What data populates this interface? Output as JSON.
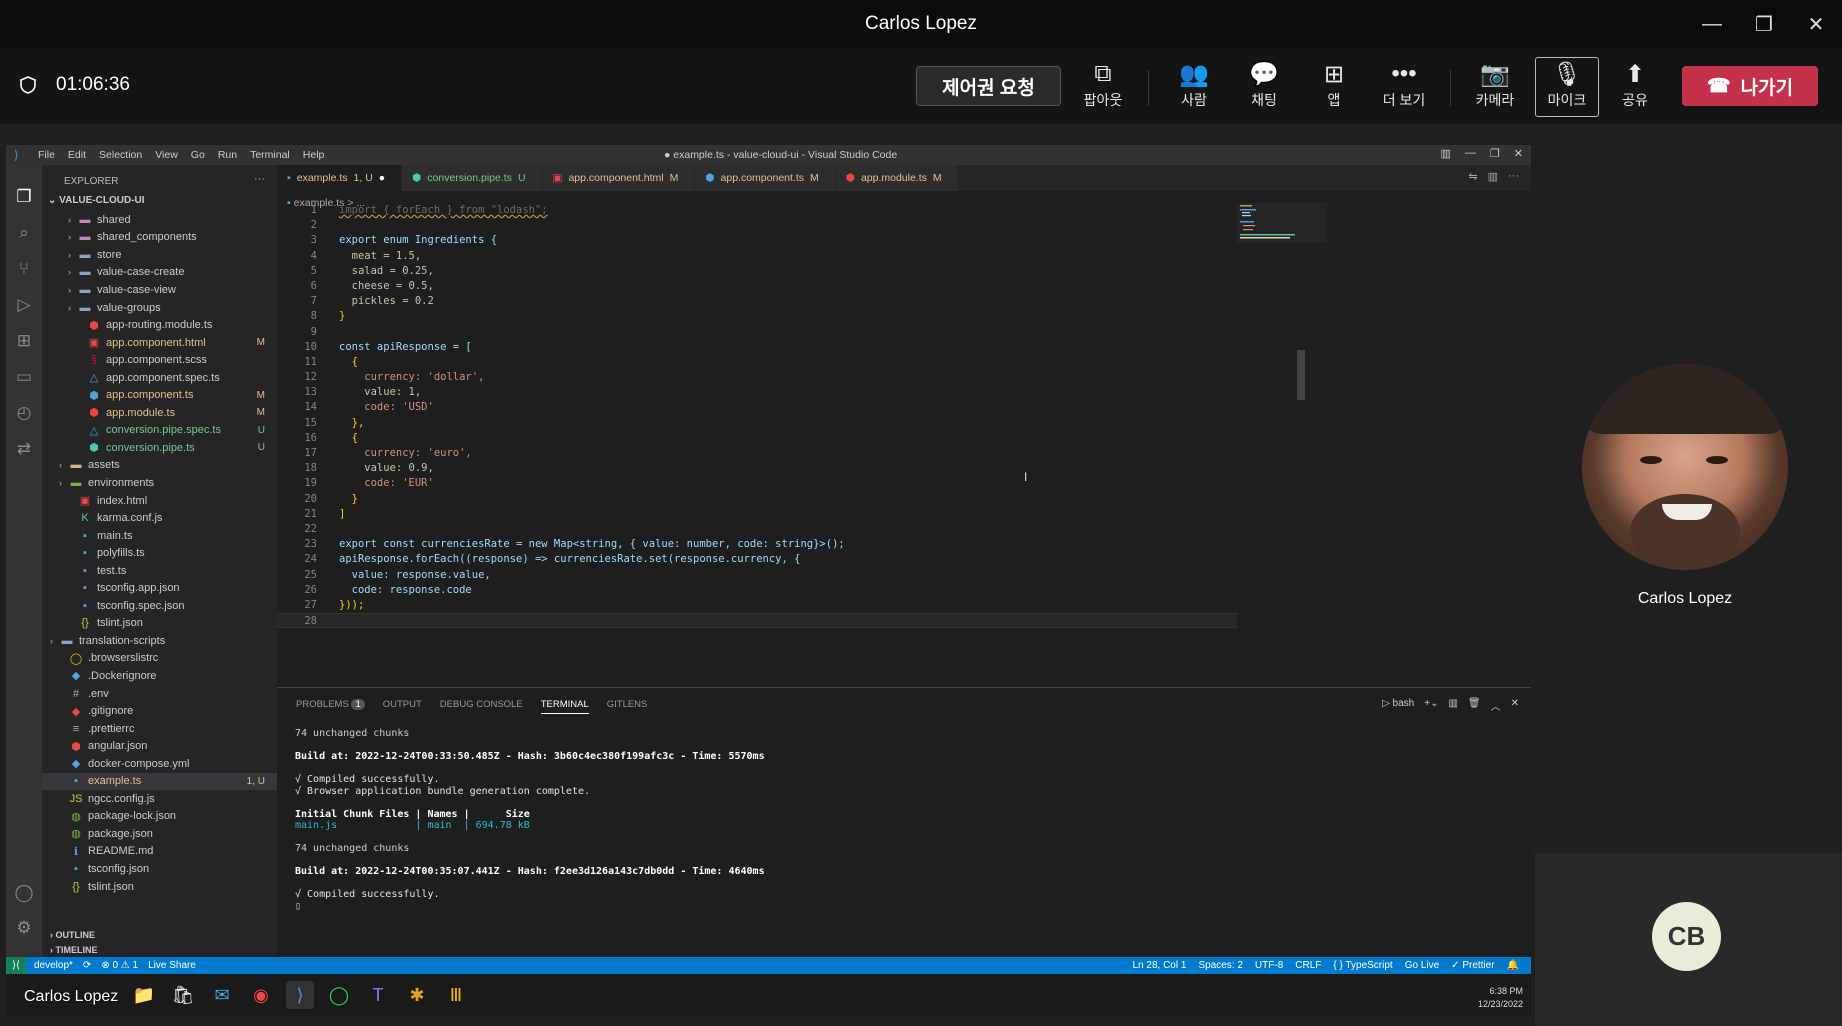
{
  "window": {
    "title": "Carlos Lopez",
    "controls": [
      "—",
      "❐",
      "✕"
    ]
  },
  "meeting": {
    "timer": "01:06:36",
    "request_control": "제어권 요청",
    "buttons": [
      {
        "label": "팝아웃",
        "icon": "popout-icon",
        "glyph": "⧉"
      },
      {
        "label": "사람",
        "icon": "people-icon",
        "glyph": "👥"
      },
      {
        "label": "채팅",
        "icon": "chat-icon",
        "glyph": "💬"
      },
      {
        "label": "앱",
        "icon": "apps-icon",
        "glyph": "⊞"
      },
      {
        "label": "더 보기",
        "icon": "more-icon",
        "glyph": "•••"
      },
      {
        "label": "카메라",
        "icon": "camera-off-icon",
        "glyph": "📷"
      },
      {
        "label": "마이크",
        "icon": "mic-icon",
        "glyph": "🎙"
      },
      {
        "label": "공유",
        "icon": "share-icon",
        "glyph": "⬆"
      }
    ],
    "leave": "나가기"
  },
  "vscode": {
    "menu": [
      "File",
      "Edit",
      "Selection",
      "View",
      "Go",
      "Run",
      "Terminal",
      "Help"
    ],
    "title": "● example.ts - value-cloud-ui - Visual Studio Code",
    "explorer_header": "EXPLORER",
    "root": "VALUE-CLOUD-UI",
    "tree": [
      {
        "label": "shared",
        "type": "folder",
        "indent": 2,
        "color": "#c586c0"
      },
      {
        "label": "shared_components",
        "type": "folder",
        "indent": 2,
        "color": "#c586c0"
      },
      {
        "label": "store",
        "type": "folder",
        "indent": 2,
        "color": "#8aa4c8"
      },
      {
        "label": "value-case-create",
        "type": "folder",
        "indent": 2,
        "color": "#8aa4c8"
      },
      {
        "label": "value-case-view",
        "type": "folder",
        "indent": 2,
        "color": "#8aa4c8"
      },
      {
        "label": "value-groups",
        "type": "folder",
        "indent": 2,
        "color": "#8aa4c8"
      },
      {
        "label": "app-routing.module.ts",
        "type": "file",
        "indent": 3,
        "icon": "⬢",
        "color": "#e44",
        "text": "#ccc"
      },
      {
        "label": "app.component.html",
        "type": "file",
        "indent": 3,
        "icon": "▣",
        "color": "#e44",
        "text": "#e2c08d",
        "status": "M"
      },
      {
        "label": "app.component.scss",
        "type": "file",
        "indent": 3,
        "icon": "§",
        "color": "#d06",
        "text": "#ccc"
      },
      {
        "label": "app.component.spec.ts",
        "type": "file",
        "indent": 3,
        "icon": "△",
        "color": "#4fa3e0",
        "text": "#ccc"
      },
      {
        "label": "app.component.ts",
        "type": "file",
        "indent": 3,
        "icon": "⬢",
        "color": "#4fa3e0",
        "text": "#e2c08d",
        "status": "M"
      },
      {
        "label": "app.module.ts",
        "type": "file",
        "indent": 3,
        "icon": "⬢",
        "color": "#e44",
        "text": "#e2c08d",
        "status": "M"
      },
      {
        "label": "conversion.pipe.spec.ts",
        "type": "file",
        "indent": 3,
        "icon": "△",
        "color": "#4fa3e0",
        "text": "#73c991",
        "status": "U"
      },
      {
        "label": "conversion.pipe.ts",
        "type": "file",
        "indent": 3,
        "icon": "⬢",
        "color": "#4ec9b0",
        "text": "#73c991",
        "status": "U"
      },
      {
        "label": "assets",
        "type": "folder",
        "indent": 1,
        "color": "#dcb67a"
      },
      {
        "label": "environments",
        "type": "folder",
        "indent": 1,
        "color": "#7cb342"
      },
      {
        "label": "index.html",
        "type": "file",
        "indent": 2,
        "icon": "▣",
        "color": "#e44",
        "text": "#ccc"
      },
      {
        "label": "karma.conf.js",
        "type": "file",
        "indent": 2,
        "icon": "K",
        "color": "#4ec9b0",
        "text": "#ccc"
      },
      {
        "label": "main.ts",
        "type": "file",
        "indent": 2,
        "icon": "▪",
        "color": "#4fa3e0",
        "text": "#ccc"
      },
      {
        "label": "polyfills.ts",
        "type": "file",
        "indent": 2,
        "icon": "▪",
        "color": "#4fa3e0",
        "text": "#ccc"
      },
      {
        "label": "test.ts",
        "type": "file",
        "indent": 2,
        "icon": "▪",
        "color": "#4fa3e0",
        "text": "#ccc"
      },
      {
        "label": "tsconfig.app.json",
        "type": "file",
        "indent": 2,
        "icon": "▪",
        "color": "#4fa3e0",
        "text": "#ccc"
      },
      {
        "label": "tsconfig.spec.json",
        "type": "file",
        "indent": 2,
        "icon": "▪",
        "color": "#4fa3e0",
        "text": "#ccc"
      },
      {
        "label": "tslint.json",
        "type": "file",
        "indent": 2,
        "icon": "{}",
        "color": "#cbcb41",
        "text": "#ccc"
      },
      {
        "label": "translation-scripts",
        "type": "folder",
        "indent": 0,
        "color": "#8aa4c8"
      },
      {
        "label": ".browserslistrc",
        "type": "file",
        "indent": 1,
        "icon": "◯",
        "color": "#f5b800",
        "text": "#ccc"
      },
      {
        "label": ".Dockerignore",
        "type": "file",
        "indent": 1,
        "icon": "◆",
        "color": "#4fa3e0",
        "text": "#ccc"
      },
      {
        "label": ".env",
        "type": "file",
        "indent": 1,
        "icon": "#",
        "color": "#aaa",
        "text": "#ccc"
      },
      {
        "label": ".gitignore",
        "type": "file",
        "indent": 1,
        "icon": "◆",
        "color": "#e44",
        "text": "#ccc"
      },
      {
        "label": ".prettierrc",
        "type": "file",
        "indent": 1,
        "icon": "≡",
        "color": "#aaa",
        "text": "#ccc"
      },
      {
        "label": "angular.json",
        "type": "file",
        "indent": 1,
        "icon": "⬢",
        "color": "#e44",
        "text": "#ccc"
      },
      {
        "label": "docker-compose.yml",
        "type": "file",
        "indent": 1,
        "icon": "◆",
        "color": "#4fa3e0",
        "text": "#ccc"
      },
      {
        "label": "example.ts",
        "type": "file",
        "indent": 1,
        "icon": "▪",
        "color": "#4fa3e0",
        "text": "#e2c08d",
        "status": "1, U",
        "selected": true
      },
      {
        "label": "ngcc.config.js",
        "type": "file",
        "indent": 1,
        "icon": "JS",
        "color": "#cbcb41",
        "text": "#ccc"
      },
      {
        "label": "package-lock.json",
        "type": "file",
        "indent": 1,
        "icon": "◍",
        "color": "#7cb342",
        "text": "#ccc"
      },
      {
        "label": "package.json",
        "type": "file",
        "indent": 1,
        "icon": "◍",
        "color": "#7cb342",
        "text": "#ccc"
      },
      {
        "label": "README.md",
        "type": "file",
        "indent": 1,
        "icon": "ℹ",
        "color": "#4fa3e0",
        "text": "#ccc"
      },
      {
        "label": "tsconfig.json",
        "type": "file",
        "indent": 1,
        "icon": "▪",
        "color": "#4fa3e0",
        "text": "#ccc"
      },
      {
        "label": "tslint.json",
        "type": "file",
        "indent": 1,
        "icon": "{}",
        "color": "#cbcb41",
        "text": "#ccc"
      }
    ],
    "outline": "OUTLINE",
    "timeline": "TIMELINE",
    "tabs": [
      {
        "label": "example.ts",
        "suffix": "1, U",
        "dirty": "●",
        "active": true,
        "color": "#e2c08d",
        "icon": "▪",
        "icon_color": "#4fa3e0"
      },
      {
        "label": "conversion.pipe.ts",
        "suffix": "U",
        "active": false,
        "color": "#73c991",
        "icon": "⬢",
        "icon_color": "#4ec9b0"
      },
      {
        "label": "app.component.html",
        "suffix": "M",
        "active": false,
        "color": "#e2c08d",
        "icon": "▣",
        "icon_color": "#e44"
      },
      {
        "label": "app.component.ts",
        "suffix": "M",
        "active": false,
        "color": "#e2c08d",
        "icon": "⬢",
        "icon_color": "#4fa3e0"
      },
      {
        "label": "app.module.ts",
        "suffix": "M",
        "active": false,
        "color": "#e2c08d",
        "icon": "⬢",
        "icon_color": "#e44"
      }
    ],
    "breadcrumb": "example.ts > ...",
    "code_lines": [
      "import { forEach } from \"lodash\";",
      "",
      "export enum Ingredients {",
      "  meat = 1.5,",
      "  salad = 0.25,",
      "  cheese = 0.5,",
      "  pickles = 0.2",
      "}",
      "",
      "const apiResponse = [",
      "  {",
      "    currency: 'dollar',",
      "    value: 1,",
      "    code: 'USD'",
      "  },",
      "  {",
      "    currency: 'euro',",
      "    value: 0.9,",
      "    code: 'EUR'",
      "  }",
      "]",
      "",
      "export const currenciesRate = new Map<string, { value: number, code: string}>();",
      "apiResponse.forEach((response) => currenciesRate.set(response.currency, {",
      "  value: response.value,",
      "  code: response.code",
      "}));",
      ""
    ],
    "panel_tabs": [
      "PROBLEMS",
      "OUTPUT",
      "DEBUG CONSOLE",
      "TERMINAL",
      "GITLENS"
    ],
    "problems_count": "1",
    "terminal_shell": "bash",
    "terminal_lines": [
      "74 unchanged chunks",
      "",
      "Build at: 2022-12-24T00:33:50.485Z - Hash: 3b60c4ec380f199afc3c - Time: 5570ms",
      "",
      "√ Compiled successfully.",
      "√ Browser application bundle generation complete.",
      "",
      "Initial Chunk Files | Names |      Size",
      "main.js             | main  | 694.78 kB",
      "",
      "74 unchanged chunks",
      "",
      "Build at: 2022-12-24T00:35:07.441Z - Hash: f2ee3d126a143c7db0dd - Time: 4640ms",
      "",
      "√ Compiled successfully.",
      "▯"
    ],
    "status_left": [
      "develop*",
      "⟳",
      "⊗ 0 ⚠ 1",
      "Live Share"
    ],
    "status_right": [
      "Ln 28, Col 1",
      "Spaces: 2",
      "UTF-8",
      "CRLF",
      "{ } TypeScript",
      "Go Live",
      "✓ Prettier"
    ],
    "clock_time": "6:38 PM",
    "clock_date": "12/23/2022",
    "caption": "Carlos Lopez"
  },
  "participants": {
    "main_name": "Carlos Lopez",
    "initials": "CB"
  },
  "colors": {
    "accent": "#007acc",
    "leave": "#c4314b"
  }
}
